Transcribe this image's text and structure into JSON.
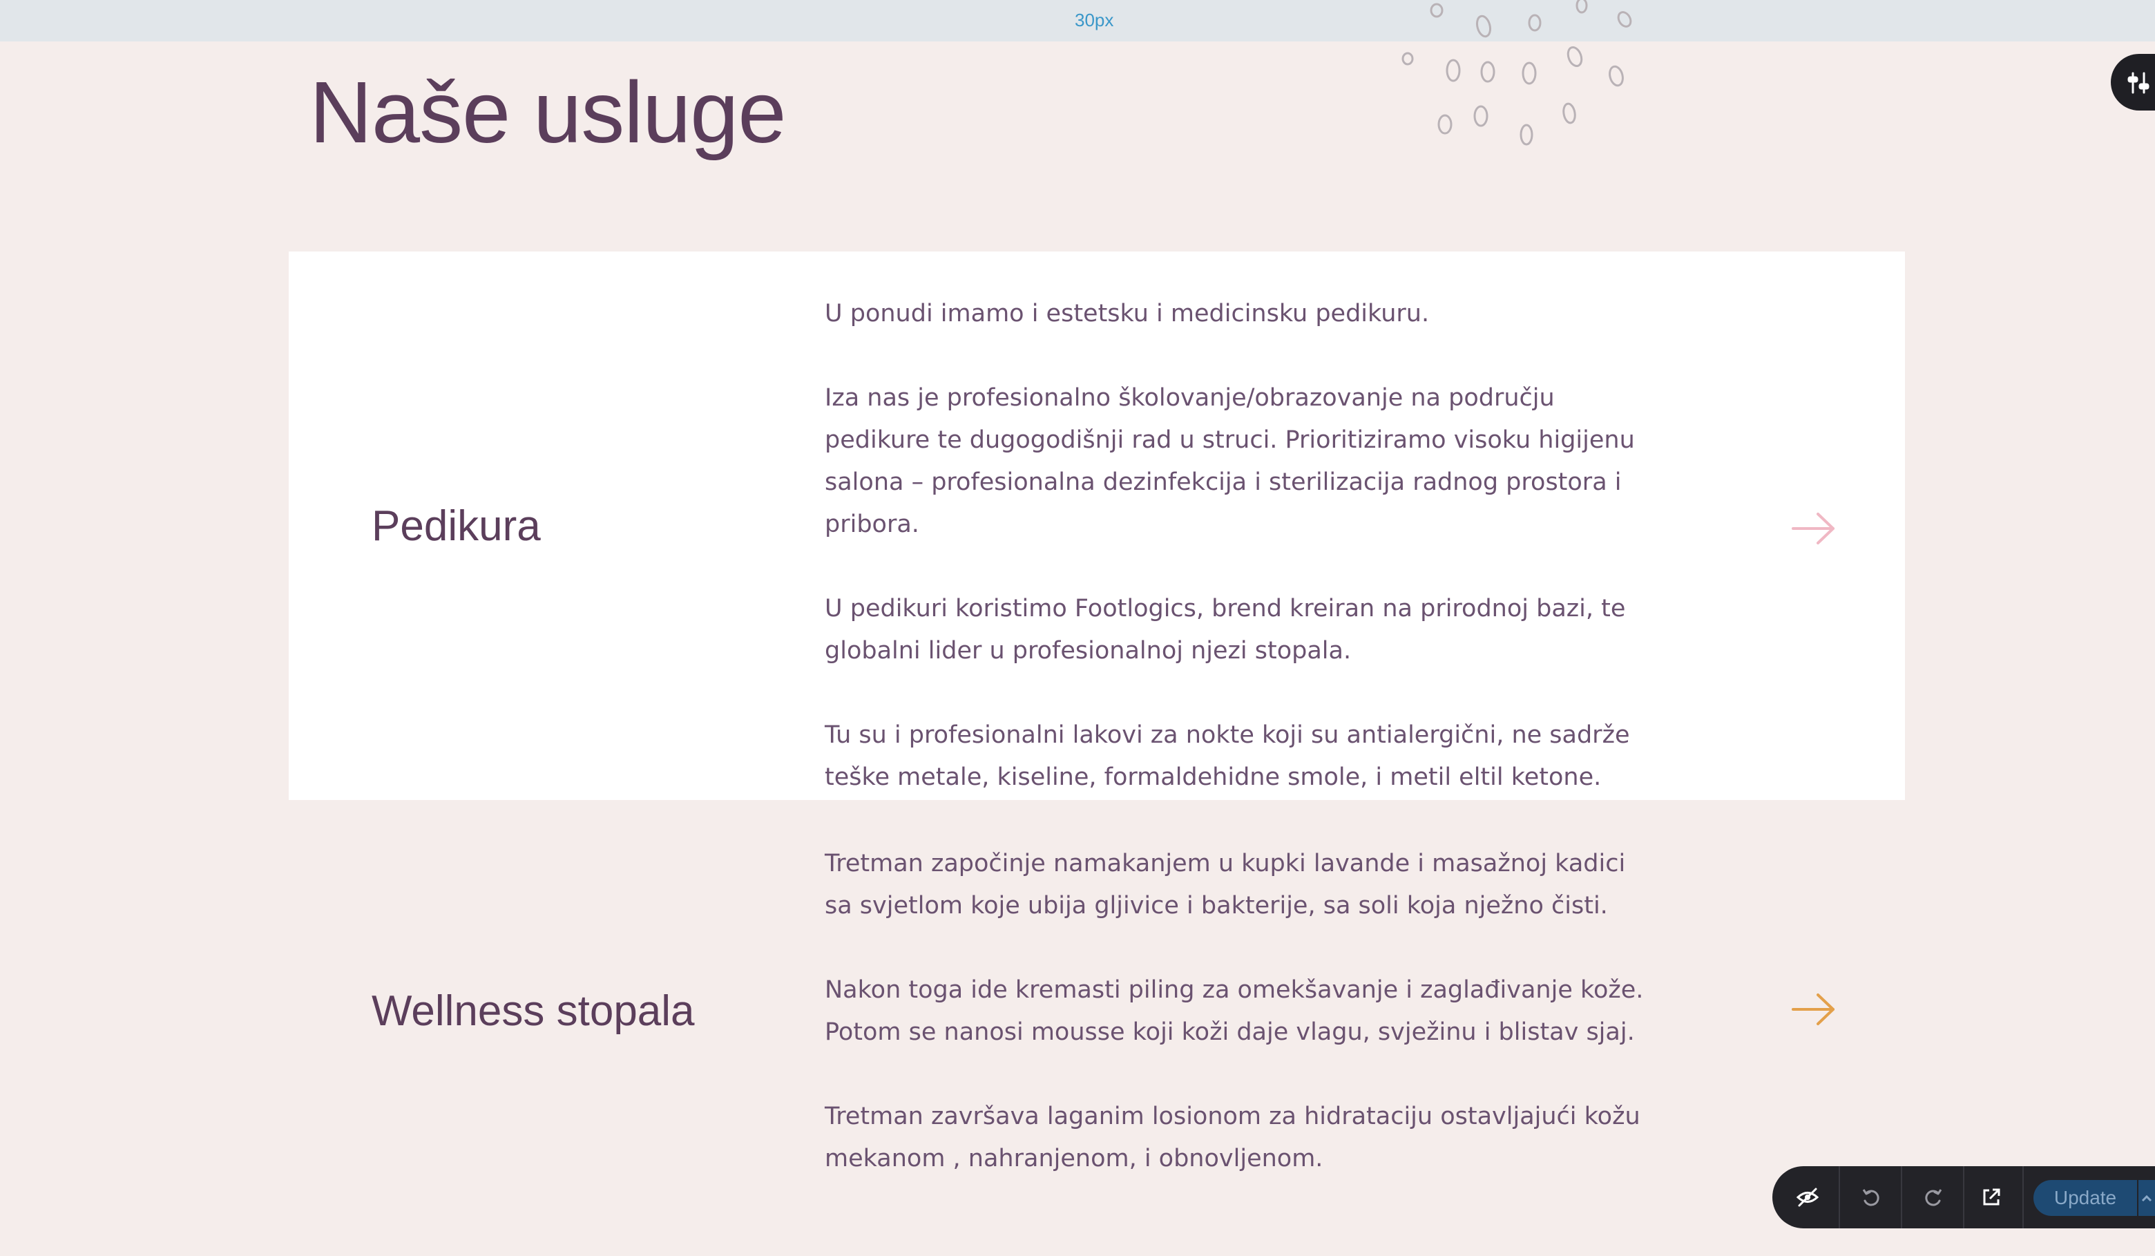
{
  "spacing_label": "30px",
  "section_title": "Naše usluge",
  "services": [
    {
      "title": "Pedikura",
      "paragraphs": [
        "U ponudi imamo i estetsku i medicinsku pedikuru.",
        "Iza nas je profesionalno školovanje/obrazovanje na području pedikure te dugogodišnji rad u struci. Prioritiziramo visoku higijenu salona – profesionalna dezinfekcija i sterilizacija radnog prostora i pribora.",
        "U pedikuri koristimo Footlogics, brend kreiran na prirodnoj bazi, te globalni lider u profesionalnoj njezi stopala.",
        "Tu su i profesionalni lakovi za nokte koji su antialergični, ne sadrže teške metale, kiseline, formaldehidne smole, i metil eltil ketone."
      ],
      "arrow_icon": "arrow-right-icon",
      "arrow_color": "#f0b8c4"
    },
    {
      "title": "Wellness stopala",
      "paragraphs": [
        "Tretman započinje namakanjem u kupki lavande i masažnoj kadici sa svjetlom koje ubija gljivice i bakterije, sa soli koja nježno čisti.",
        "Nakon toga ide kremasti piling za omekšavanje i zaglađivanje kože. Potom se nanosi mousse koji koži daje vlagu, svježinu i blistav sjaj.",
        "Tretman završava laganim losionom za hidrataciju ostavljajući kožu mekanom , nahranjenom, i obnovljenom."
      ],
      "arrow_icon": "arrow-right-icon",
      "arrow_color": "#e3a04a"
    }
  ],
  "toolbar": {
    "update_label": "Update",
    "icons": [
      "eye-off-icon",
      "undo-icon",
      "redo-icon",
      "external-link-icon",
      "chevron-up-icon"
    ]
  },
  "side_tab_icon": "sliders-icon",
  "colors": {
    "page_bg": "#f5edeb",
    "card_bg": "#ffffff",
    "heading": "#5b3e5b",
    "body_text": "#6a5270"
  }
}
